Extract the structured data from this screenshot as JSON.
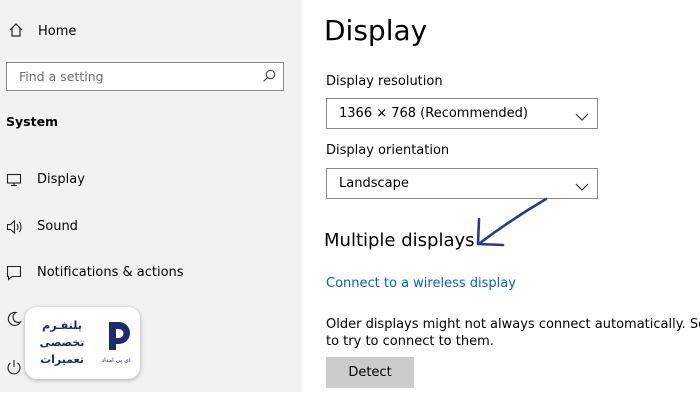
{
  "sidebar": {
    "home": {
      "label": "Home",
      "icon": "home-icon"
    },
    "search": {
      "placeholder": "Find a setting",
      "icon": "search-icon"
    },
    "section_title": "System",
    "items": [
      {
        "label": "Display",
        "icon": "monitor-icon"
      },
      {
        "label": "Sound",
        "icon": "speaker-icon"
      },
      {
        "label": "Notifications & actions",
        "icon": "notification-icon"
      },
      {
        "label": "",
        "icon": "moon-icon"
      },
      {
        "label": "",
        "icon": "power-icon"
      }
    ]
  },
  "main": {
    "title": "Display",
    "resolution": {
      "label": "Display resolution",
      "value": "1366 × 768 (Recommended)"
    },
    "orientation": {
      "label": "Display orientation",
      "value": "Landscape"
    },
    "multiple_displays": {
      "title": "Multiple displays",
      "link": "Connect to a wireless display",
      "description_lines": [
        "Older displays might not always connect automatically. Select",
        "to try to connect to them."
      ],
      "detect_button": "Detect"
    }
  },
  "annotation": {
    "arrow_color": "#2b3a86"
  },
  "watermark": {
    "lines": [
      "پلتفـرم",
      "تخصصی",
      "تعمیرات"
    ],
    "sub": "ای پی امداد"
  },
  "colors": {
    "sidebar_bg": "#f2f2f2",
    "link": "#0067c0",
    "button_bg": "#cccccc"
  }
}
